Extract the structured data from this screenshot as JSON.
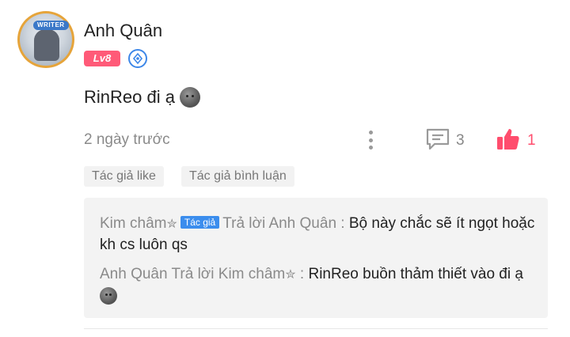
{
  "comment": {
    "username": "Anh Quân",
    "level": "Lv8",
    "avatar_badge": "WRITER",
    "text": "RinReo đi ạ",
    "timestamp": "2 ngày trước",
    "reply_count": "3",
    "like_count": "1"
  },
  "tags": {
    "author_like": "Tác giả like",
    "author_reply": "Tác giả bình luận"
  },
  "replies": [
    {
      "name": "Kim châm",
      "author_chip": "Tác giả",
      "reply_to": "Trả lời Anh Quân :",
      "text": "Bộ này chắc sẽ ít ngọt hoặc kh cs luôn qs"
    },
    {
      "name": "Anh Quân",
      "reply_to": "Trả lời Kim châm",
      "colon": ":",
      "text": "RinReo buồn thảm thiết vào đi ạ"
    }
  ],
  "colors": {
    "accent_like": "#ff4d6d",
    "level_badge": "#ff5a78",
    "author_chip": "#3b8ded"
  },
  "icons": [
    "verified-icon",
    "more-icon",
    "reply-icon",
    "like-icon",
    "star-icon",
    "emoji-icon"
  ]
}
